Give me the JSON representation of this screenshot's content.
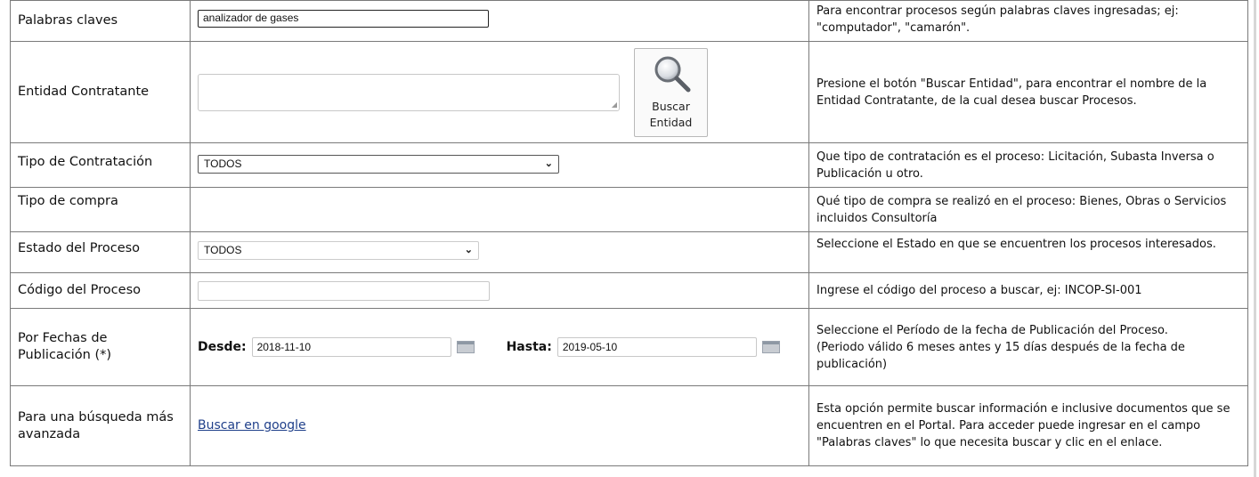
{
  "rows": {
    "keywords": {
      "label": "Palabras claves",
      "value": "analizador de gases",
      "help": "Para encontrar procesos según palabras claves ingresadas; ej: \"computador\", \"camarón\"."
    },
    "entity": {
      "label": "Entidad Contratante",
      "value": "",
      "button_line1": "Buscar",
      "button_line2": "Entidad",
      "help": "Presione el botón \"Buscar Entidad\", para encontrar el nombre de la Entidad Contratante, de la cual desea buscar Procesos."
    },
    "contract_type": {
      "label": "Tipo de Contratación",
      "selected": "TODOS",
      "help": "Que tipo de contratación es el proceso: Licitación, Subasta Inversa o Publicación u otro."
    },
    "purchase_type": {
      "label": "Tipo de compra",
      "help": "Qué tipo de compra se realizó en el proceso: Bienes, Obras o Servicios incluidos Consultoría"
    },
    "status": {
      "label": "Estado del Proceso",
      "selected": "TODOS",
      "help": "Seleccione el Estado en que se encuentren los procesos interesados."
    },
    "code": {
      "label": "Código del Proceso",
      "value": "",
      "help": "Ingrese el código del proceso a buscar, ej: INCOP-SI-001"
    },
    "dates": {
      "label": "Por Fechas de Publicación (*)",
      "from_label": "Desde:",
      "from_value": "2018-11-10",
      "to_label": "Hasta:",
      "to_value": "2019-05-10",
      "help": "Seleccione el Período de la fecha de Publicación del Proceso.",
      "help_note": "(Periodo válido 6 meses antes y 15 días después de la fecha de publicación)"
    },
    "advanced": {
      "label": "Para una búsqueda más avanzada",
      "link": "Buscar en google",
      "help": "Esta opción permite buscar información e inclusive documentos que se encuentren en el Portal. Para acceder puede ingresar en el campo \"Palabras claves\" lo que necesita buscar y clic en el enlace."
    }
  },
  "icons": {
    "entity_button": "magnifier-icon",
    "select_arrow": "chevron-down-icon",
    "date_picker": "calendar-icon"
  }
}
